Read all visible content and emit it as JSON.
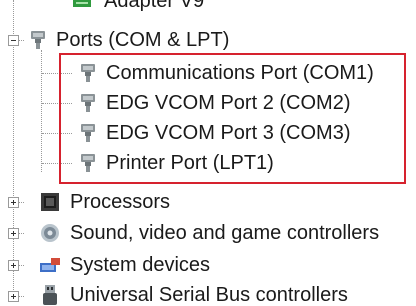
{
  "tree": {
    "partial_top_label": "Adapter V9",
    "ports": {
      "label": "Ports (COM & LPT)",
      "children": [
        {
          "label": "Communications Port (COM1)",
          "icon": "port-connector-icon"
        },
        {
          "label": "EDG VCOM Port 2 (COM2)",
          "icon": "port-connector-icon"
        },
        {
          "label": "EDG VCOM Port 3 (COM3)",
          "icon": "port-connector-icon"
        },
        {
          "label": "Printer Port (LPT1)",
          "icon": "port-connector-icon"
        }
      ]
    },
    "categories": [
      {
        "label": "Processors",
        "icon": "processor-chip-icon"
      },
      {
        "label": "Sound, video and game controllers",
        "icon": "speaker-icon"
      },
      {
        "label": "System devices",
        "icon": "system-devices-icon"
      },
      {
        "label": "Universal Serial Bus controllers",
        "icon": "usb-plug-icon"
      }
    ]
  },
  "colors": {
    "highlight": "#d6222e",
    "text": "#1a1a1a",
    "tree_lines": "#9a9a9a"
  }
}
